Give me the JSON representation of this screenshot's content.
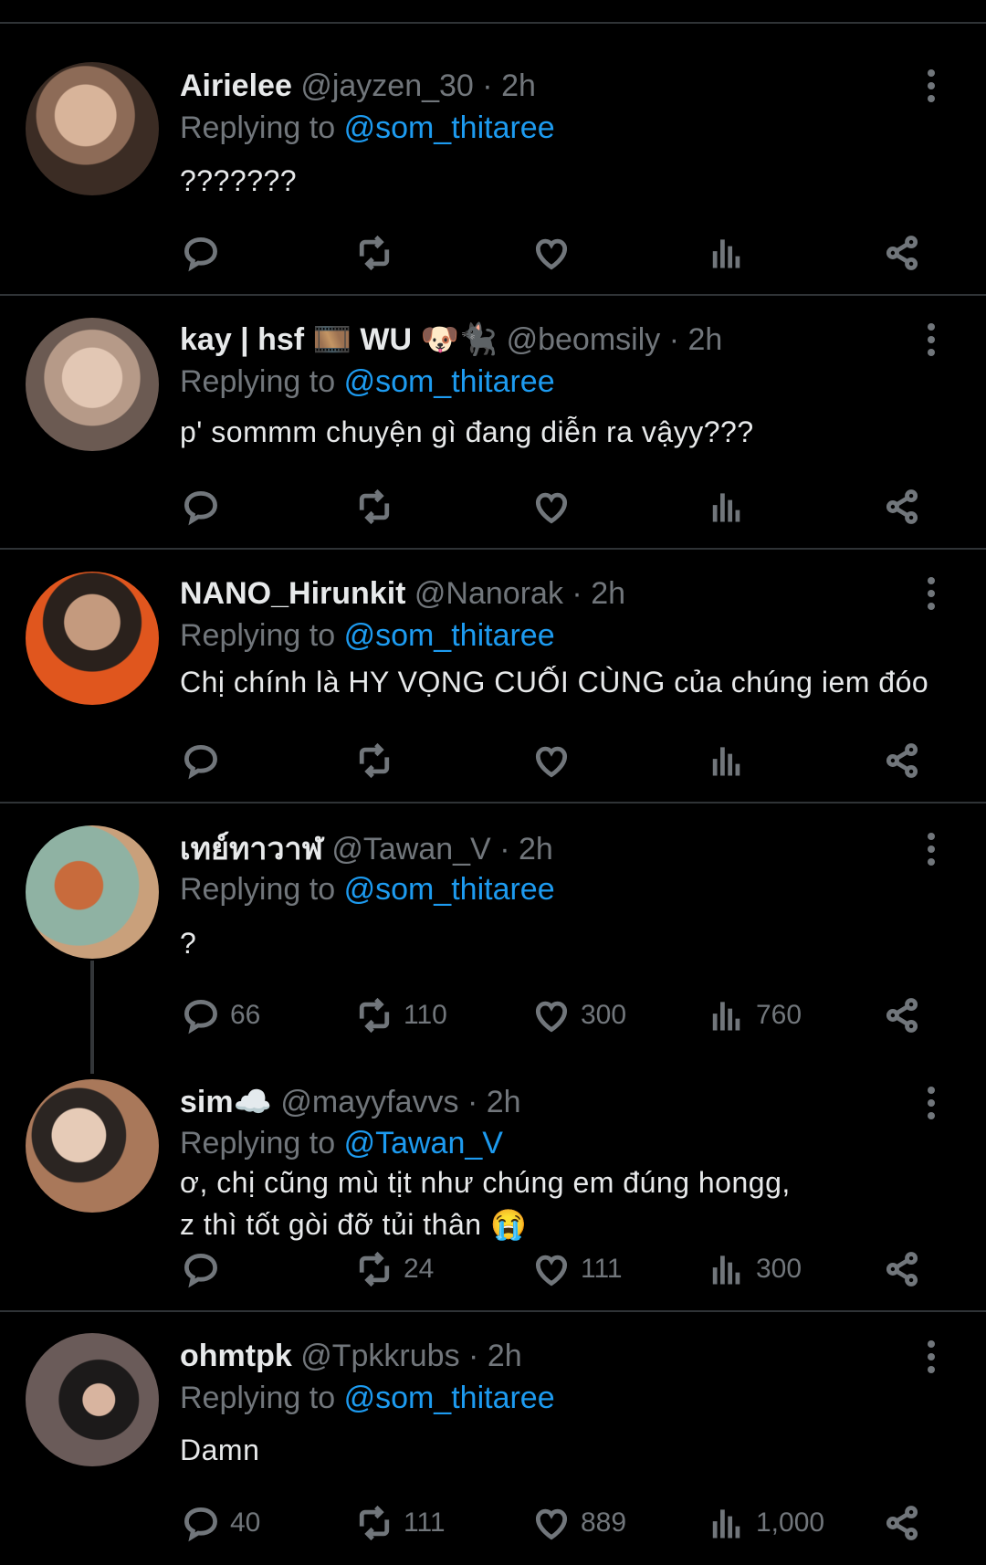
{
  "tweets": [
    {
      "name": "Airielee",
      "handle": "@jayzen_30",
      "time": "2h",
      "replying_label": "Replying to",
      "replying_to": "@som_thitaree",
      "text": "???????",
      "counts": {
        "replies": "",
        "retweets": "",
        "likes": "",
        "views": ""
      }
    },
    {
      "name": "kay | hsf 🎞️ WU 🐶🐈‍⬛",
      "handle": "@beomsily",
      "time": "2h",
      "replying_label": "Replying to",
      "replying_to": "@som_thitaree",
      "text": "p' sommm chuyện gì đang diễn ra vậyy???",
      "counts": {
        "replies": "",
        "retweets": "",
        "likes": "",
        "views": ""
      }
    },
    {
      "name": "NANO_Hirunkit",
      "handle": "@Nanorak",
      "time": "2h",
      "replying_label": "Replying to",
      "replying_to": "@som_thitaree",
      "text": "Chị chính là HY VỌNG CUỐI CÙNG của chúng iem đóo",
      "counts": {
        "replies": "",
        "retweets": "",
        "likes": "",
        "views": ""
      }
    },
    {
      "name": "เทย์ทาวาฬ",
      "handle": "@Tawan_V",
      "time": "2h",
      "replying_label": "Replying to",
      "replying_to": "@som_thitaree",
      "text": "?",
      "counts": {
        "replies": "66",
        "retweets": "110",
        "likes": "300",
        "views": "760"
      }
    },
    {
      "name": "sim☁️",
      "handle": "@mayyfavvs",
      "time": "2h",
      "replying_label": "Replying to",
      "replying_to": "@Tawan_V",
      "text": "ơ, chị cũng mù tịt như chúng em đúng hongg,\nz thì tốt gòi đỡ tủi thân 😭",
      "counts": {
        "replies": "",
        "retweets": "24",
        "likes": "111",
        "views": "300"
      }
    },
    {
      "name": "ohmtpk",
      "handle": "@Tpkkrubs",
      "time": "2h",
      "replying_label": "Replying to",
      "replying_to": "@som_thitaree",
      "text": "Damn",
      "counts": {
        "replies": "40",
        "retweets": "111",
        "likes": "889",
        "views": "1,000"
      }
    }
  ],
  "colors": {
    "background": "#000000",
    "text": "#e7e9ea",
    "muted": "#71767b",
    "link": "#1d9bf0",
    "divider": "#2f3336"
  },
  "icons": [
    "reply-icon",
    "retweet-icon",
    "like-icon",
    "views-icon",
    "share-icon",
    "more-icon"
  ]
}
